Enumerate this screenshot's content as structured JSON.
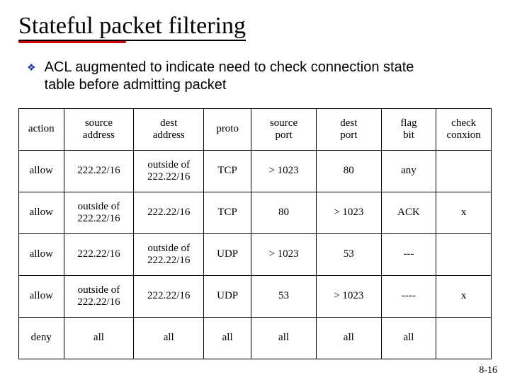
{
  "title": "Stateful packet filtering",
  "bullet": "ACL augmented to indicate need to check connection state table before admitting packet",
  "headers": [
    "action",
    "source\naddress",
    "dest\naddress",
    "proto",
    "source\nport",
    "dest\nport",
    "flag\nbit",
    "check\nconxion"
  ],
  "rows": [
    [
      "allow",
      "222.22/16",
      "outside of\n222.22/16",
      "TCP",
      "> 1023",
      "80",
      "any",
      ""
    ],
    [
      "allow",
      "outside of\n222.22/16",
      "222.22/16",
      "TCP",
      "80",
      "> 1023",
      "ACK",
      "x"
    ],
    [
      "allow",
      "222.22/16",
      "outside of\n222.22/16",
      "UDP",
      "> 1023",
      "53",
      "---",
      ""
    ],
    [
      "allow",
      "outside of\n222.22/16",
      "222.22/16",
      "UDP",
      "53",
      "> 1023",
      "----",
      "x"
    ],
    [
      "deny",
      "all",
      "all",
      "all",
      "all",
      "all",
      "all",
      ""
    ]
  ],
  "footer": "8-16",
  "chart_data": {
    "type": "table",
    "title": "ACL state table",
    "columns": [
      "action",
      "source address",
      "dest address",
      "proto",
      "source port",
      "dest port",
      "flag bit",
      "check conxion"
    ],
    "data": [
      {
        "action": "allow",
        "source address": "222.22/16",
        "dest address": "outside of 222.22/16",
        "proto": "TCP",
        "source port": "> 1023",
        "dest port": "80",
        "flag bit": "any",
        "check conxion": ""
      },
      {
        "action": "allow",
        "source address": "outside of 222.22/16",
        "dest address": "222.22/16",
        "proto": "TCP",
        "source port": "80",
        "dest port": "> 1023",
        "flag bit": "ACK",
        "check conxion": "x"
      },
      {
        "action": "allow",
        "source address": "222.22/16",
        "dest address": "outside of 222.22/16",
        "proto": "UDP",
        "source port": "> 1023",
        "dest port": "53",
        "flag bit": "---",
        "check conxion": ""
      },
      {
        "action": "allow",
        "source address": "outside of 222.22/16",
        "dest address": "222.22/16",
        "proto": "UDP",
        "source port": "53",
        "dest port": "> 1023",
        "flag bit": "----",
        "check conxion": "x"
      },
      {
        "action": "deny",
        "source address": "all",
        "dest address": "all",
        "proto": "all",
        "source port": "all",
        "dest port": "all",
        "flag bit": "all",
        "check conxion": ""
      }
    ]
  }
}
